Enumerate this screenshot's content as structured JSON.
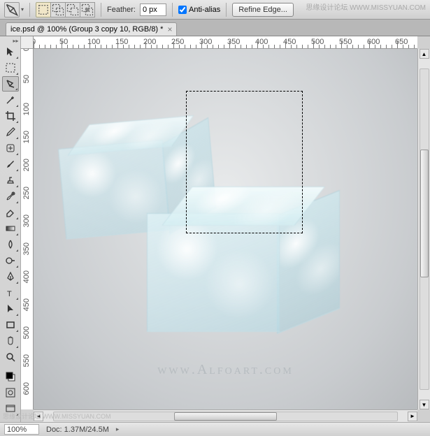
{
  "watermarkTop": "思缘设计论坛 WWW.MISSYUAN.COM",
  "watermarkBottom": "思缘设计论坛 WWW.MISSYUAN.COM",
  "optionsBar": {
    "featherLabel": "Feather:",
    "featherValue": "0 px",
    "antiAliasLabel": "Anti-alias",
    "antiAliasChecked": true,
    "refineEdgeLabel": "Refine Edge..."
  },
  "tab": {
    "title": "ice.psd @ 100% (Group 3 copy 10, RGB/8) *",
    "closeGlyph": "×"
  },
  "rulerH": [
    "0",
    "50",
    "100",
    "150",
    "200",
    "250",
    "300",
    "350",
    "400",
    "450",
    "500",
    "550",
    "600",
    "650"
  ],
  "rulerV": [
    "0",
    "50",
    "100",
    "150",
    "200",
    "250",
    "300",
    "350",
    "400",
    "450",
    "500",
    "550",
    "600"
  ],
  "canvas": {
    "watermark": "www.Alfoart.com"
  },
  "status": {
    "zoom": "100%",
    "docInfo": "Doc: 1.37M/24.5M"
  },
  "tools": [
    "move",
    "rect-marquee",
    "lasso",
    "magic-wand",
    "crop",
    "eyedropper",
    "healing",
    "brush",
    "stamp",
    "history-brush",
    "eraser",
    "gradient",
    "blur",
    "dodge",
    "pen",
    "type",
    "path-select",
    "rectangle",
    "hand",
    "zoom",
    "swap",
    "rotate-view",
    "quick-mask"
  ],
  "icons": {
    "lassoDrop": "▾",
    "arrL": "◄",
    "arrR": "►",
    "arrU": "▲",
    "arrD": "▼",
    "arrMore": "▸"
  }
}
